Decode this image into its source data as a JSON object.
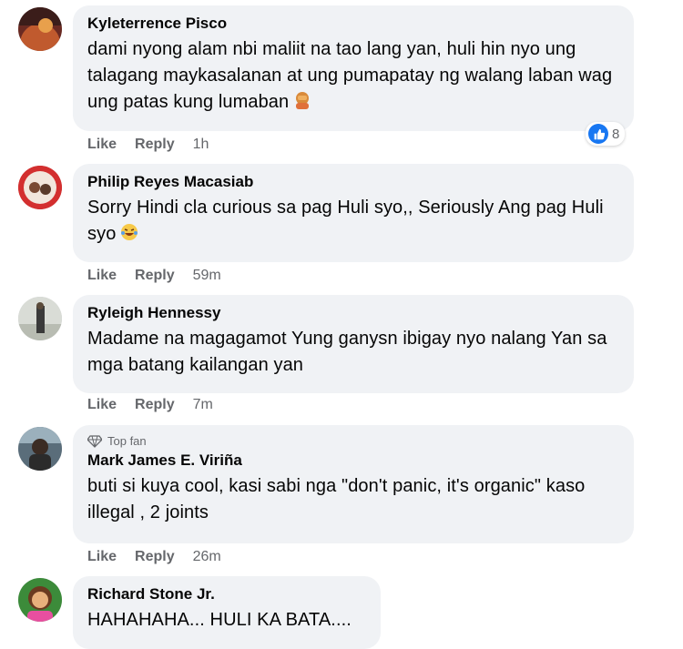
{
  "comments": [
    {
      "name": "Kyleterrence Pisco",
      "text": "dami nyong alam nbi maliit na tao lang yan, huli hin nyo ung talagang maykasalanan at ung pumapatay ng walang laban wag ung patas kung lumaban",
      "like": "Like",
      "reply": "Reply",
      "time": "1h",
      "reaction_count": "8"
    },
    {
      "name": "Philip Reyes Macasiab",
      "text": "Sorry Hindi cla curious sa pag Huli syo,, Seriously Ang pag Huli syo",
      "like": "Like",
      "reply": "Reply",
      "time": "59m"
    },
    {
      "name": "Ryleigh Hennessy",
      "text": "Madame na magagamot Yung ganysn ibigay nyo nalang Yan sa mga batang kailangan yan",
      "like": "Like",
      "reply": "Reply",
      "time": "7m"
    },
    {
      "badge": "Top fan",
      "name": "Mark James E. Viriña",
      "text": "buti si kuya cool, kasi sabi nga \"don't panic, it's organic\" kaso illegal , 2 joints",
      "like": "Like",
      "reply": "Reply",
      "time": "26m"
    },
    {
      "name": "Richard Stone Jr.",
      "text": "HAHAHAHA... HULI KA BATA...."
    }
  ],
  "icons": {
    "reaction": "like-icon",
    "badge": "diamond-icon",
    "emoji1": "facepalm-emoji",
    "emoji2": "laughing-emoji"
  },
  "colors": {
    "bubble": "#f0f2f5",
    "secondary_text": "#65676b",
    "like_blue": "#1877f2"
  }
}
